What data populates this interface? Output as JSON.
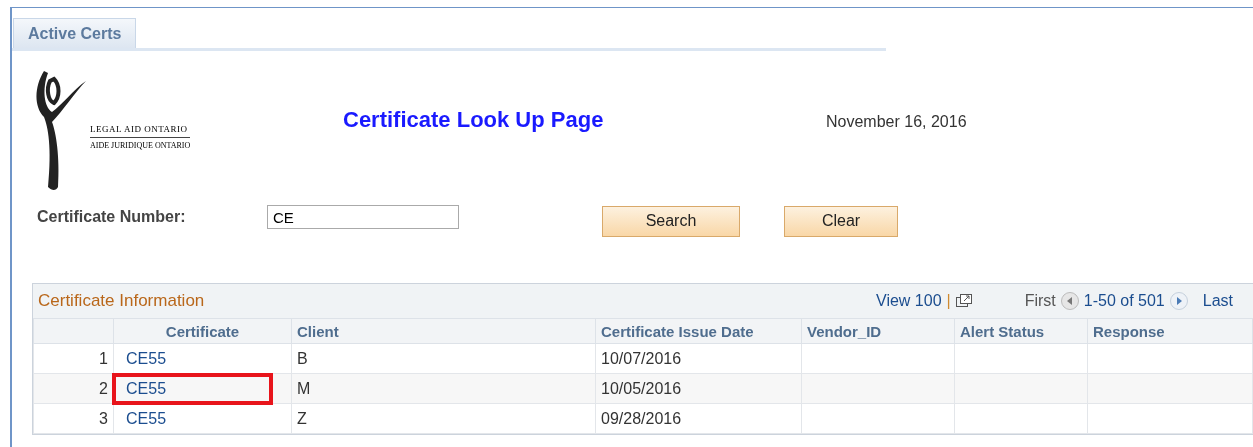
{
  "tabs": [
    {
      "label": "Active Certs",
      "selected": true
    }
  ],
  "logo": {
    "line_1": "LEGAL AID ONTARIO",
    "line_2": "AIDE JURIDIQUE ONTARIO"
  },
  "page_title": "Certificate Look Up Page",
  "date": "November 16, 2016",
  "form": {
    "label": "Certificate Number:",
    "value": "CE",
    "buttons": [
      "Search",
      "Clear"
    ]
  },
  "grid": {
    "title": "Certificate Information",
    "view_link": "View 100",
    "separator": "|",
    "first": "First",
    "range": "1-50 of 501",
    "last": "Last",
    "columns": [
      "Certificate",
      "Client",
      "Certificate Issue Date",
      "Vendor_ID",
      "Alert Status",
      "Response"
    ],
    "rows": [
      {
        "number": "1",
        "certificate": "CE55",
        "client": "B",
        "issue_date": "10/07/2016",
        "highlighted": false
      },
      {
        "number": "2",
        "certificate": "CE55",
        "client": "M",
        "issue_date": "10/05/2016",
        "highlighted": true
      },
      {
        "number": "3",
        "certificate": "CE55",
        "client": "Z",
        "issue_date": "09/28/2016",
        "highlighted": false
      }
    ]
  }
}
